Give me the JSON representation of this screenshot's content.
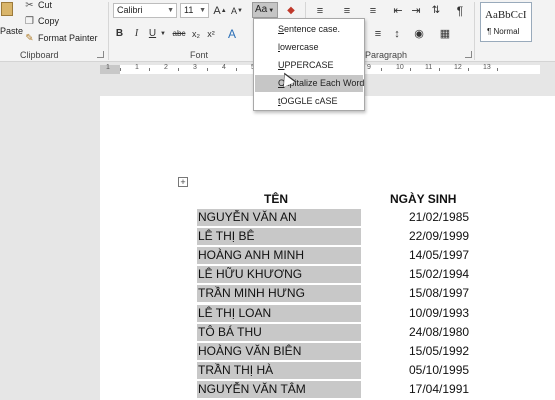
{
  "ribbon": {
    "clipboard": {
      "paste_label": "Paste",
      "cut_label": "Cut",
      "copy_label": "Copy",
      "format_painter_label": "Format Painter",
      "group_label": "Clipboard"
    },
    "font": {
      "font_name": "Calibri",
      "font_size": "11",
      "grow_label": "A",
      "shrink_label": "A",
      "change_case_label": "Aa",
      "bold_label": "B",
      "italic_label": "I",
      "underline_label": "U",
      "strikethrough_label": "abc",
      "subscript_label": "x₂",
      "superscript_label": "x²",
      "text_effects_label": "A",
      "group_label": "Font"
    },
    "paragraph": {
      "group_label": "Paragraph"
    },
    "styles": {
      "sample": "AaBbCcI",
      "name": "¶ Normal"
    }
  },
  "ruler": {
    "numbers": [
      "1",
      "1",
      "2",
      "3",
      "4",
      "5",
      "6",
      "7",
      "8",
      "9",
      "10",
      "11",
      "12",
      "13"
    ]
  },
  "case_menu": {
    "items": [
      {
        "underline": "S",
        "rest": "entence case."
      },
      {
        "underline": "l",
        "rest": "owercase"
      },
      {
        "underline": "U",
        "rest": "PPERCASE"
      },
      {
        "underline": "C",
        "rest": "apitalize Each Word"
      },
      {
        "underline": "t",
        "rest": "OGGLE cASE"
      }
    ],
    "hovered_index": 3
  },
  "table": {
    "headers": {
      "name": "TÊN",
      "birth": "NGÀY SINH"
    },
    "rows": [
      {
        "name": "NGUYỄN VĂN AN",
        "date": "21/02/1985"
      },
      {
        "name": "LÊ THỊ BÊ",
        "date": "22/09/1999"
      },
      {
        "name": "HOÀNG ANH MINH",
        "date": "14/05/1997"
      },
      {
        "name": "LÊ HỮU KHƯƠNG",
        "date": "15/02/1994"
      },
      {
        "name": "TRẦN MINH HƯNG",
        "date": "15/08/1997"
      },
      {
        "name": "LÊ THỊ LOAN",
        "date": "10/09/1993"
      },
      {
        "name": "TÔ BÁ THU",
        "date": "24/08/1980"
      },
      {
        "name": "HOÀNG VĂN BIÊN",
        "date": "15/05/1992"
      },
      {
        "name": "TRẦN THỊ HÀ",
        "date": "05/10/1995"
      },
      {
        "name": "NGUYỄN VĂN TÂM",
        "date": "17/04/1991"
      }
    ]
  },
  "colors": {
    "ribbon_bg": "#f3f3f3",
    "selection_gray": "#c8c8c8",
    "menu_hover": "#c6c6c6"
  }
}
